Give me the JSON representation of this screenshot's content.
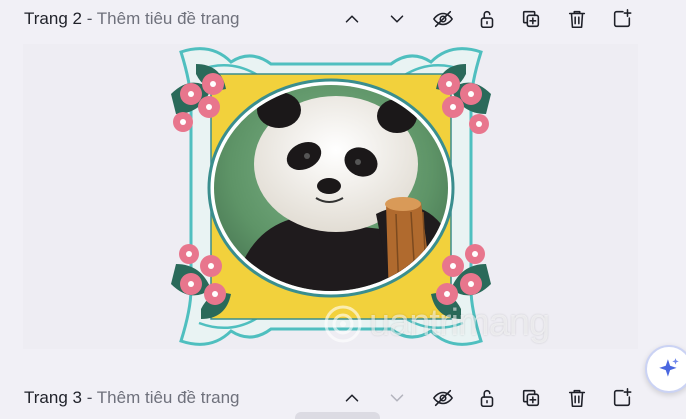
{
  "pages": [
    {
      "label": "Trang 2",
      "separator": "-",
      "subtitle": "Thêm tiêu đề trang"
    },
    {
      "label": "Trang 3",
      "separator": "-",
      "subtitle": "Thêm tiêu đề trang"
    }
  ],
  "toolbar_icons": [
    "chevron-up-icon",
    "chevron-down-icon",
    "eye-off-icon",
    "lock-open-icon",
    "duplicate-page-icon",
    "trash-icon",
    "add-page-icon"
  ],
  "watermark": {
    "text": "uantrimang"
  },
  "colors": {
    "frame_yellow": "#f2d13c",
    "frame_teal": "#4fbfbf",
    "flower_pink": "#e8768d",
    "leaf_green": "#2a6a5a",
    "ai_accent": "#4a67e0"
  }
}
